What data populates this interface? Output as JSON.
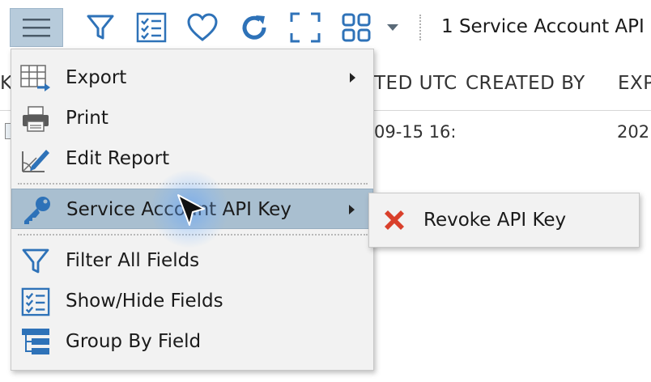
{
  "toolbar": {
    "icons": [
      "hamburger-menu-icon",
      "filter-icon",
      "checklist-icon",
      "heart-icon",
      "refresh-icon",
      "fullscreen-icon",
      "grid-view-icon",
      "chevron-down-icon"
    ],
    "title": "1 Service Account API"
  },
  "grid": {
    "columns": [
      "K",
      "TED UTC",
      "CREATED BY",
      "EXP"
    ],
    "rows": [
      {
        "created_partial": "09-15 16:",
        "expires_partial": "202"
      }
    ]
  },
  "menu": {
    "items": [
      {
        "label": "Export",
        "icon": "export-table-icon",
        "submenu": true
      },
      {
        "label": "Print",
        "icon": "printer-icon",
        "submenu": false
      },
      {
        "label": "Edit Report",
        "icon": "edit-report-icon",
        "submenu": false
      },
      {
        "label": "Service Account API Key",
        "icon": "key-icon",
        "submenu": true,
        "highlighted": true
      },
      {
        "label": "Filter All Fields",
        "icon": "filter-icon",
        "submenu": false
      },
      {
        "label": "Show/Hide Fields",
        "icon": "checklist-icon",
        "submenu": false
      },
      {
        "label": "Group By Field",
        "icon": "group-tree-icon",
        "submenu": false
      }
    ]
  },
  "submenu": {
    "items": [
      {
        "label": "Revoke API Key",
        "icon": "red-x-icon"
      }
    ]
  },
  "colors": {
    "accent_blue": "#2e72b8",
    "highlight": "#a9bfd0",
    "revoke_red": "#d9402b"
  }
}
